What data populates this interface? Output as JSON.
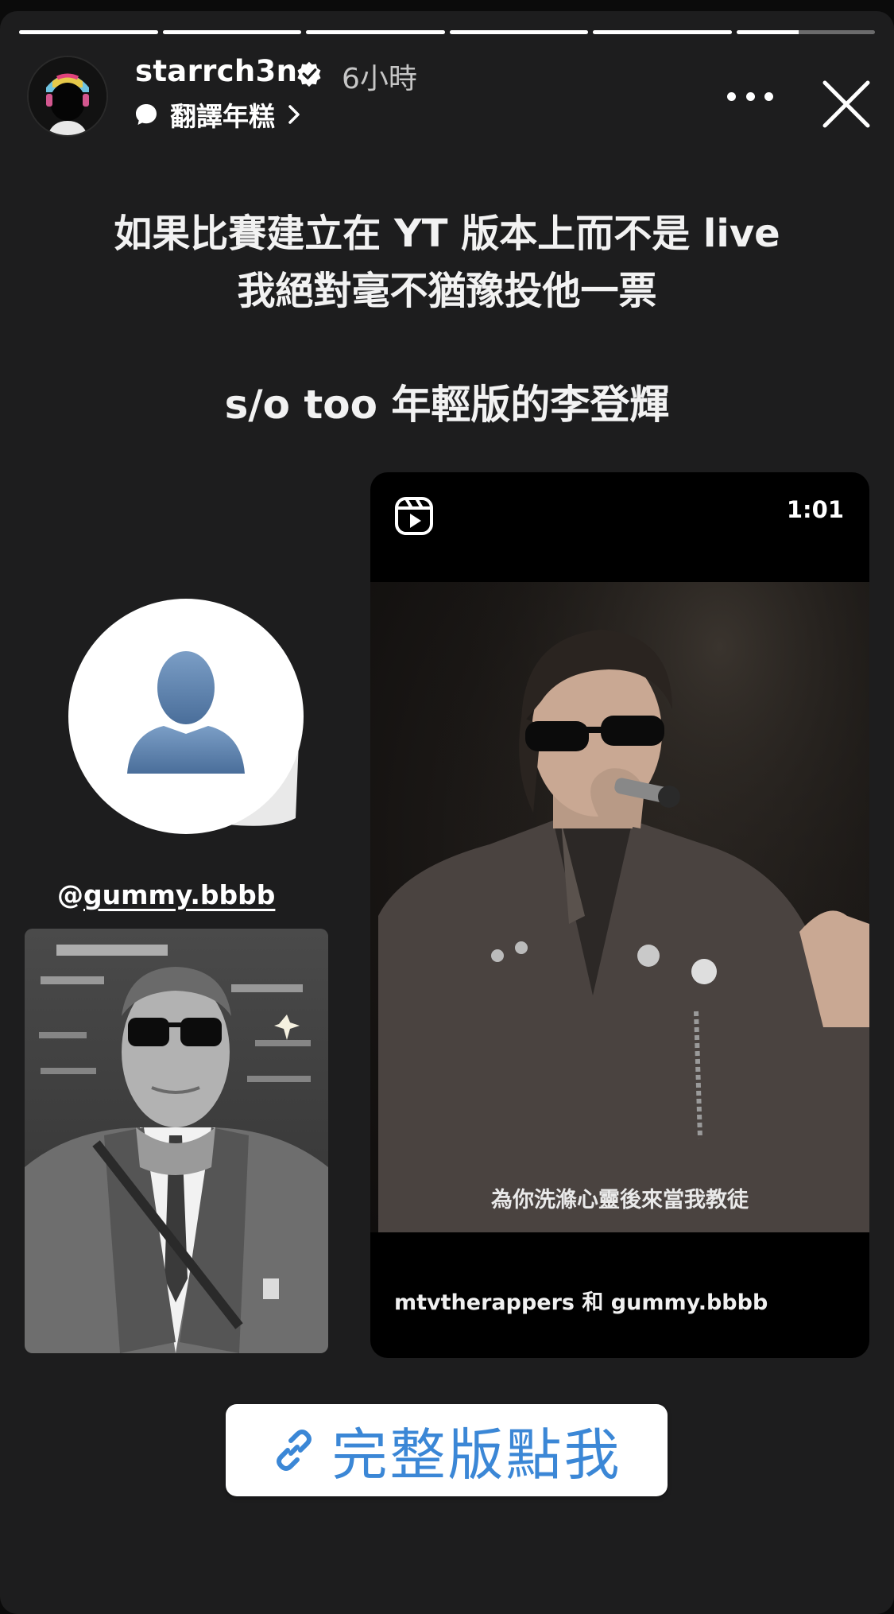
{
  "story": {
    "progress": [
      1,
      1,
      1,
      1,
      1,
      0.45
    ],
    "username": "starrch3n",
    "time_ago": "6小時",
    "translate_label": "翻譯年糕"
  },
  "caption": {
    "line1": "如果比賽建立在 YT 版本上而不是 live",
    "line2": "我絕對毫不猶豫投他一票",
    "line3": "s/o too 年輕版的李登輝"
  },
  "mention": {
    "at": "@",
    "handle": "gummy.bbbb"
  },
  "reel": {
    "duration": "1:01",
    "subtitle": "為你洗滌心靈後來當我教徒",
    "caption": "mtvtherappers 和 gummy.bbbb"
  },
  "link_sticker": {
    "label": "完整版點我",
    "color": "#3b87d6"
  },
  "icons": [
    "verified-badge-icon",
    "speech-bubble-icon",
    "chevron-right-icon",
    "more-icon",
    "close-icon",
    "reels-icon",
    "link-icon",
    "default-avatar-icon"
  ]
}
